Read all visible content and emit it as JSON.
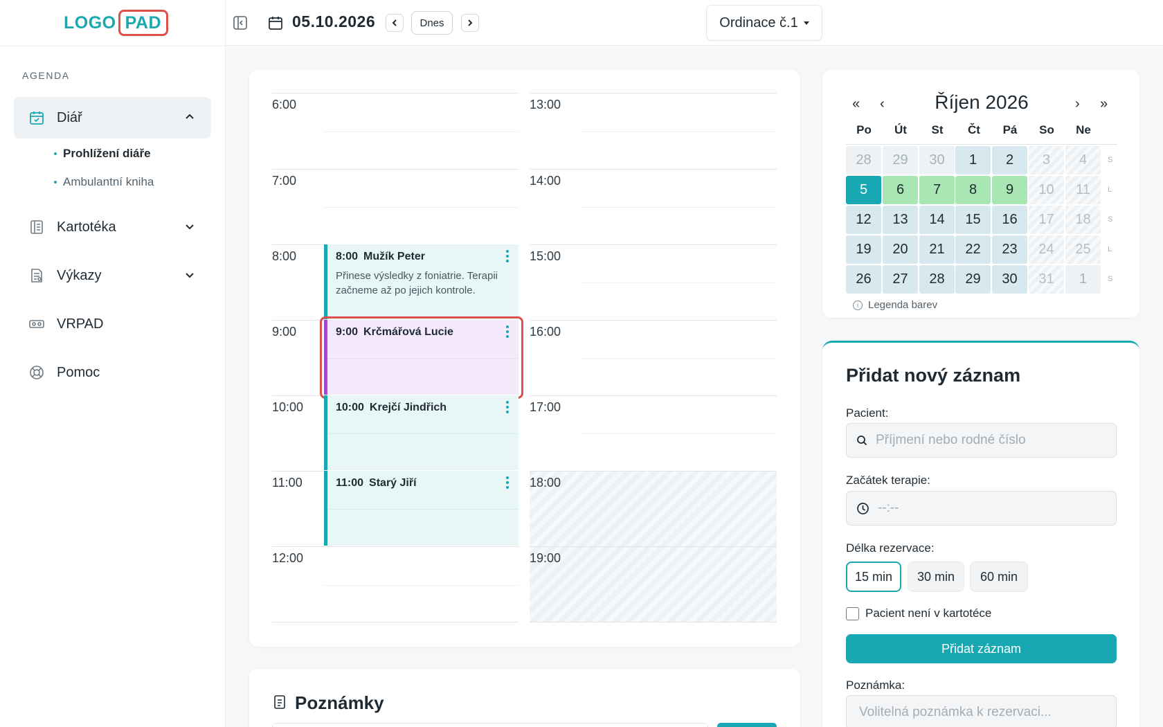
{
  "logo": {
    "part1": "LOGO",
    "part2": "PAD"
  },
  "sidebar": {
    "section_label": "AGENDA",
    "items": [
      {
        "label": "Diář",
        "icon": "calendar-check-icon",
        "expanded": true
      },
      {
        "label": "Kartotéka",
        "icon": "book-icon",
        "expanded": false
      },
      {
        "label": "Výkazy",
        "icon": "report-icon",
        "expanded": false
      },
      {
        "label": "VRPAD",
        "icon": "vr-headset-icon"
      },
      {
        "label": "Pomoc",
        "icon": "lifebuoy-icon"
      }
    ],
    "subitems": [
      {
        "label": "Prohlížení diáře",
        "current": true
      },
      {
        "label": "Ambulantní kniha",
        "current": false
      }
    ]
  },
  "topbar": {
    "date": "05.10.2026",
    "today_label": "Dnes",
    "clinic": "Ordinace č.1"
  },
  "schedule": {
    "left_hours": [
      "6:00",
      "7:00",
      "8:00",
      "9:00",
      "10:00",
      "11:00",
      "12:00"
    ],
    "right_hours": [
      "13:00",
      "14:00",
      "15:00",
      "16:00",
      "17:00",
      "18:00",
      "19:00"
    ],
    "appointments": [
      {
        "time": "8:00",
        "name": "Mužík Peter",
        "note": "Přinese výsledky z foniatrie. Terapii začneme až po jejich kontrole.",
        "color": "#1aa8b0"
      },
      {
        "time": "9:00",
        "name": "Krčmářová Lucie",
        "note": "",
        "color": "#9b4dcc",
        "highlighted": true
      },
      {
        "time": "10:00",
        "name": "Krejčí Jindřich",
        "note": "",
        "color": "#1aa8b0"
      },
      {
        "time": "11:00",
        "name": "Starý Jiří",
        "note": "",
        "color": "#1aa8b0"
      }
    ]
  },
  "notes": {
    "title": "Poznámky"
  },
  "calendar": {
    "nav": {
      "prev_year": "«",
      "prev_month": "‹",
      "next_month": "›",
      "next_year": "»"
    },
    "title": "Říjen 2026",
    "weekdays": [
      "Po",
      "Út",
      "St",
      "Čt",
      "Pá",
      "So",
      "Ne"
    ],
    "weeks": [
      {
        "tag": "S",
        "days": [
          {
            "d": "28",
            "k": "other"
          },
          {
            "d": "29",
            "k": "other"
          },
          {
            "d": "30",
            "k": "other"
          },
          {
            "d": "1",
            "k": "cur"
          },
          {
            "d": "2",
            "k": "cur"
          },
          {
            "d": "3",
            "k": "weekend"
          },
          {
            "d": "4",
            "k": "weekend"
          }
        ]
      },
      {
        "tag": "L",
        "days": [
          {
            "d": "5",
            "k": "today"
          },
          {
            "d": "6",
            "k": "green"
          },
          {
            "d": "7",
            "k": "green"
          },
          {
            "d": "8",
            "k": "green"
          },
          {
            "d": "9",
            "k": "green"
          },
          {
            "d": "10",
            "k": "weekend"
          },
          {
            "d": "11",
            "k": "weekend"
          }
        ]
      },
      {
        "tag": "S",
        "days": [
          {
            "d": "12",
            "k": "cur"
          },
          {
            "d": "13",
            "k": "cur"
          },
          {
            "d": "14",
            "k": "cur"
          },
          {
            "d": "15",
            "k": "cur"
          },
          {
            "d": "16",
            "k": "cur"
          },
          {
            "d": "17",
            "k": "weekend"
          },
          {
            "d": "18",
            "k": "weekend"
          }
        ]
      },
      {
        "tag": "L",
        "days": [
          {
            "d": "19",
            "k": "cur"
          },
          {
            "d": "20",
            "k": "cur"
          },
          {
            "d": "21",
            "k": "cur"
          },
          {
            "d": "22",
            "k": "cur"
          },
          {
            "d": "23",
            "k": "cur"
          },
          {
            "d": "24",
            "k": "weekend"
          },
          {
            "d": "25",
            "k": "weekend"
          }
        ]
      },
      {
        "tag": "S",
        "days": [
          {
            "d": "26",
            "k": "cur"
          },
          {
            "d": "27",
            "k": "cur"
          },
          {
            "d": "28",
            "k": "cur"
          },
          {
            "d": "29",
            "k": "cur"
          },
          {
            "d": "30",
            "k": "cur"
          },
          {
            "d": "31",
            "k": "weekend"
          },
          {
            "d": "1",
            "k": "other"
          }
        ]
      }
    ],
    "legend": "Legenda barev"
  },
  "form": {
    "title": "Přidat nový záznam",
    "patient_label": "Pacient:",
    "patient_placeholder": "Příjmení nebo rodné číslo",
    "start_label": "Začátek terapie:",
    "start_placeholder": "--:--",
    "duration_label": "Délka rezervace:",
    "durations": [
      "15 min",
      "30 min",
      "60 min"
    ],
    "selected_duration": "15 min",
    "not_in_registry": "Pacient není v kartotéce",
    "submit": "Přidat záznam",
    "note_label": "Poznámka:",
    "note_placeholder": "Volitelná poznámka k rezervaci..."
  },
  "colors": {
    "accent": "#17a8b4",
    "highlight": "#e0504a",
    "purple": "#9b4dcc"
  }
}
